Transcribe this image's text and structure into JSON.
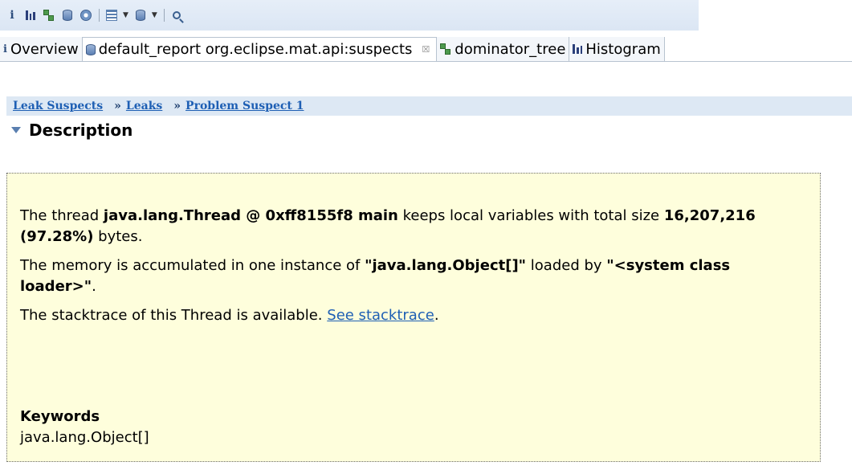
{
  "toolbar": {
    "icons": [
      "info-icon",
      "histogram-icon",
      "dominator-tree-icon",
      "oql-icon",
      "heap-dump-overview-icon",
      "query-browser-icon",
      "dropdown-arrow",
      "report-icon",
      "dropdown-arrow",
      "search-icon"
    ]
  },
  "tabs": [
    {
      "label": "Overview",
      "icon": "info-icon",
      "active": false
    },
    {
      "label": "default_report  org.eclipse.mat.api:suspects",
      "icon": "report-icon",
      "active": true,
      "close": "☒"
    },
    {
      "label": "dominator_tree",
      "icon": "dominator-tree-icon",
      "active": false
    },
    {
      "label": "Histogram",
      "icon": "histogram-icon",
      "active": false
    }
  ],
  "breadcrumb": {
    "items": [
      "Leak Suspects",
      "Leaks",
      "Problem Suspect 1"
    ],
    "separator": "»"
  },
  "section": {
    "title": "Description"
  },
  "description": {
    "p1_a": "The thread ",
    "p1_b": "java.lang.Thread @ 0xff8155f8 main",
    "p1_c": " keeps local variables with total size ",
    "p1_d": "16,207,216 (97.28%)",
    "p1_e": " bytes.",
    "p2_a": "The memory is accumulated in one instance of ",
    "p2_b": "\"java.lang.Object[]\"",
    "p2_c": " loaded by ",
    "p2_d": "\"<system class loader>\"",
    "p2_e": ".",
    "p3_a": "The stacktrace of this Thread is available. ",
    "p3_link": "See stacktrace",
    "p3_c": ".",
    "keywords_title": "Keywords",
    "keywords_value": "java.lang.Object[]"
  },
  "colors": {
    "box_bg": "#fefedc",
    "link": "#1e5fb4",
    "breadcrumb_bg": "#dde8f4"
  }
}
